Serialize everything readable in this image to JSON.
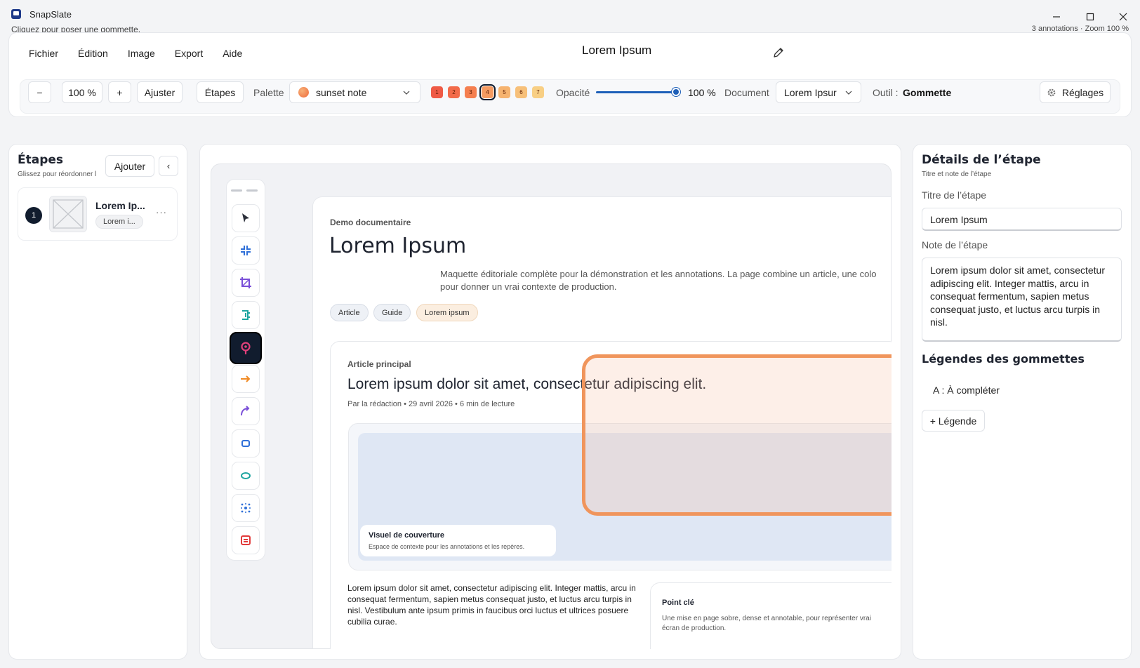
{
  "window": {
    "title": "SnapSlate",
    "status_left": "Cliquez pour poser une gommette.",
    "status_right": "3 annotations · Zoom 100 %"
  },
  "menu": [
    "Fichier",
    "Édition",
    "Image",
    "Export",
    "Aide"
  ],
  "document_title": "Lorem Ipsum",
  "toolbar": {
    "zoom_out": "−",
    "zoom_value": "100 %",
    "zoom_in": "+",
    "fit": "Ajuster",
    "steps": "Étapes",
    "palette_label": "Palette",
    "palette_value": "sunset note",
    "swatches": [
      {
        "label": "1",
        "color": "#ef5a45"
      },
      {
        "label": "2",
        "color": "#f26b4a"
      },
      {
        "label": "3",
        "color": "#f57f4f"
      },
      {
        "label": "4",
        "color": "#f49a61"
      },
      {
        "label": "5",
        "color": "#f6b36f"
      },
      {
        "label": "6",
        "color": "#f7c079"
      },
      {
        "label": "7",
        "color": "#f8cf84"
      }
    ],
    "opacity_label": "Opacité",
    "opacity_value": "100 %",
    "document_label": "Document",
    "document_value": "Lorem Ipsur",
    "tool_label": "Outil :",
    "tool_value": "Gommette",
    "settings": "Réglages"
  },
  "steps_panel": {
    "title": "Étapes",
    "subtitle": "Glissez pour réordonner l",
    "add": "Ajouter",
    "collapse": "‹",
    "items": [
      {
        "number": "1",
        "title": "Lorem Ip...",
        "tag": "Lorem i...",
        "more": "···"
      }
    ]
  },
  "tools": [
    "select-icon",
    "compress-icon",
    "crop-icon",
    "resize-icon",
    "badge-pin-icon",
    "arrow-icon",
    "curve-arrow-icon",
    "rectangle-icon",
    "ellipse-icon",
    "blur-icon",
    "redact-icon"
  ],
  "page": {
    "kicker": "Demo documentaire",
    "title": "Lorem Ipsum",
    "intro": "Maquette éditoriale complète pour la démonstration et les annotations. La page combine un article, une colo pour donner un vrai contexte de production.",
    "chips": [
      "Article",
      "Guide",
      "Lorem ipsum"
    ],
    "article": {
      "kicker": "Article principal",
      "headline": "Lorem ipsum dolor sit amet, consectetur adipiscing elit.",
      "byline": "Par la rédaction • 29 avril 2026 • 6 min de lecture",
      "cover_title": "Visuel de couverture",
      "cover_desc": "Espace de contexte pour les annotations et les repères.",
      "body": "Lorem ipsum dolor sit amet, consectetur adipiscing elit. Integer mattis, arcu in consequat fermentum, sapien metus consequat justo, et luctus arcu turpis in nisl. Vestibulum ante ipsum primis in faucibus orci luctus et ultrices posuere cubilia curae.",
      "keypoint_title": "Point clé",
      "keypoint_desc": "Une mise en page sobre, dense et annotable, pour représenter vrai écran de production."
    }
  },
  "details_panel": {
    "title": "Détails de l’étape",
    "subtitle": "Titre et note de l’étape",
    "step_title_label": "Titre de l’étape",
    "step_title_value": "Lorem Ipsum",
    "note_label": "Note de l’étape",
    "note_value": "Lorem ipsum dolor sit amet, consectetur adipiscing elit. Integer mattis, arcu in consequat fermentum, sapien metus consequat justo, et luctus arcu turpis in nisl.",
    "legends_title": "Légendes des gommettes",
    "legends": [
      "A : À compléter"
    ],
    "add_legend": "+ Légende"
  },
  "colors": {
    "accent": "#1d5fb8",
    "annotation": "#f0955c",
    "active_tool": "#111c2e"
  }
}
